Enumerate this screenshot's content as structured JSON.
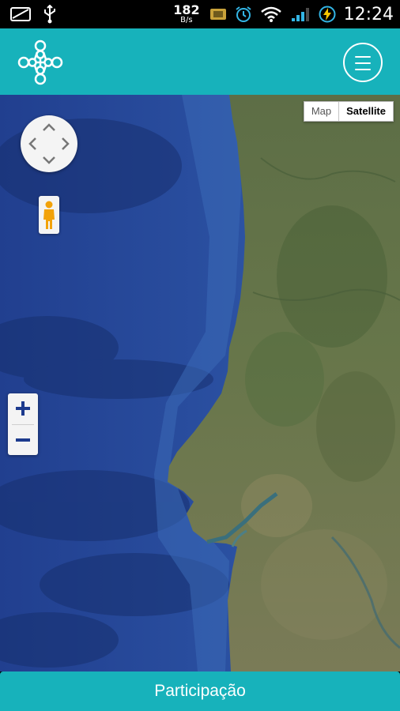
{
  "status_bar": {
    "net_speed": "182",
    "net_speed_unit": "B/s",
    "time": "12:24",
    "icons": [
      "email-icon",
      "usb-icon",
      "sim-card-icon",
      "alarm-icon",
      "wifi-icon",
      "signal-icon",
      "battery-charging-icon"
    ]
  },
  "header": {
    "logo_icon": "network-logo-icon",
    "menu_icon": "hamburger-menu-icon",
    "accent_color": "#17b2bb"
  },
  "map": {
    "type_control": {
      "map_label": "Map",
      "satellite_label": "Satellite",
      "selected": "Satellite"
    },
    "controls": [
      "pan-control",
      "street-view-pegman",
      "zoom-in",
      "zoom-out"
    ],
    "zoom_in_label": "+",
    "zoom_out_label": "−"
  },
  "footer": {
    "button_label": "Participação"
  }
}
